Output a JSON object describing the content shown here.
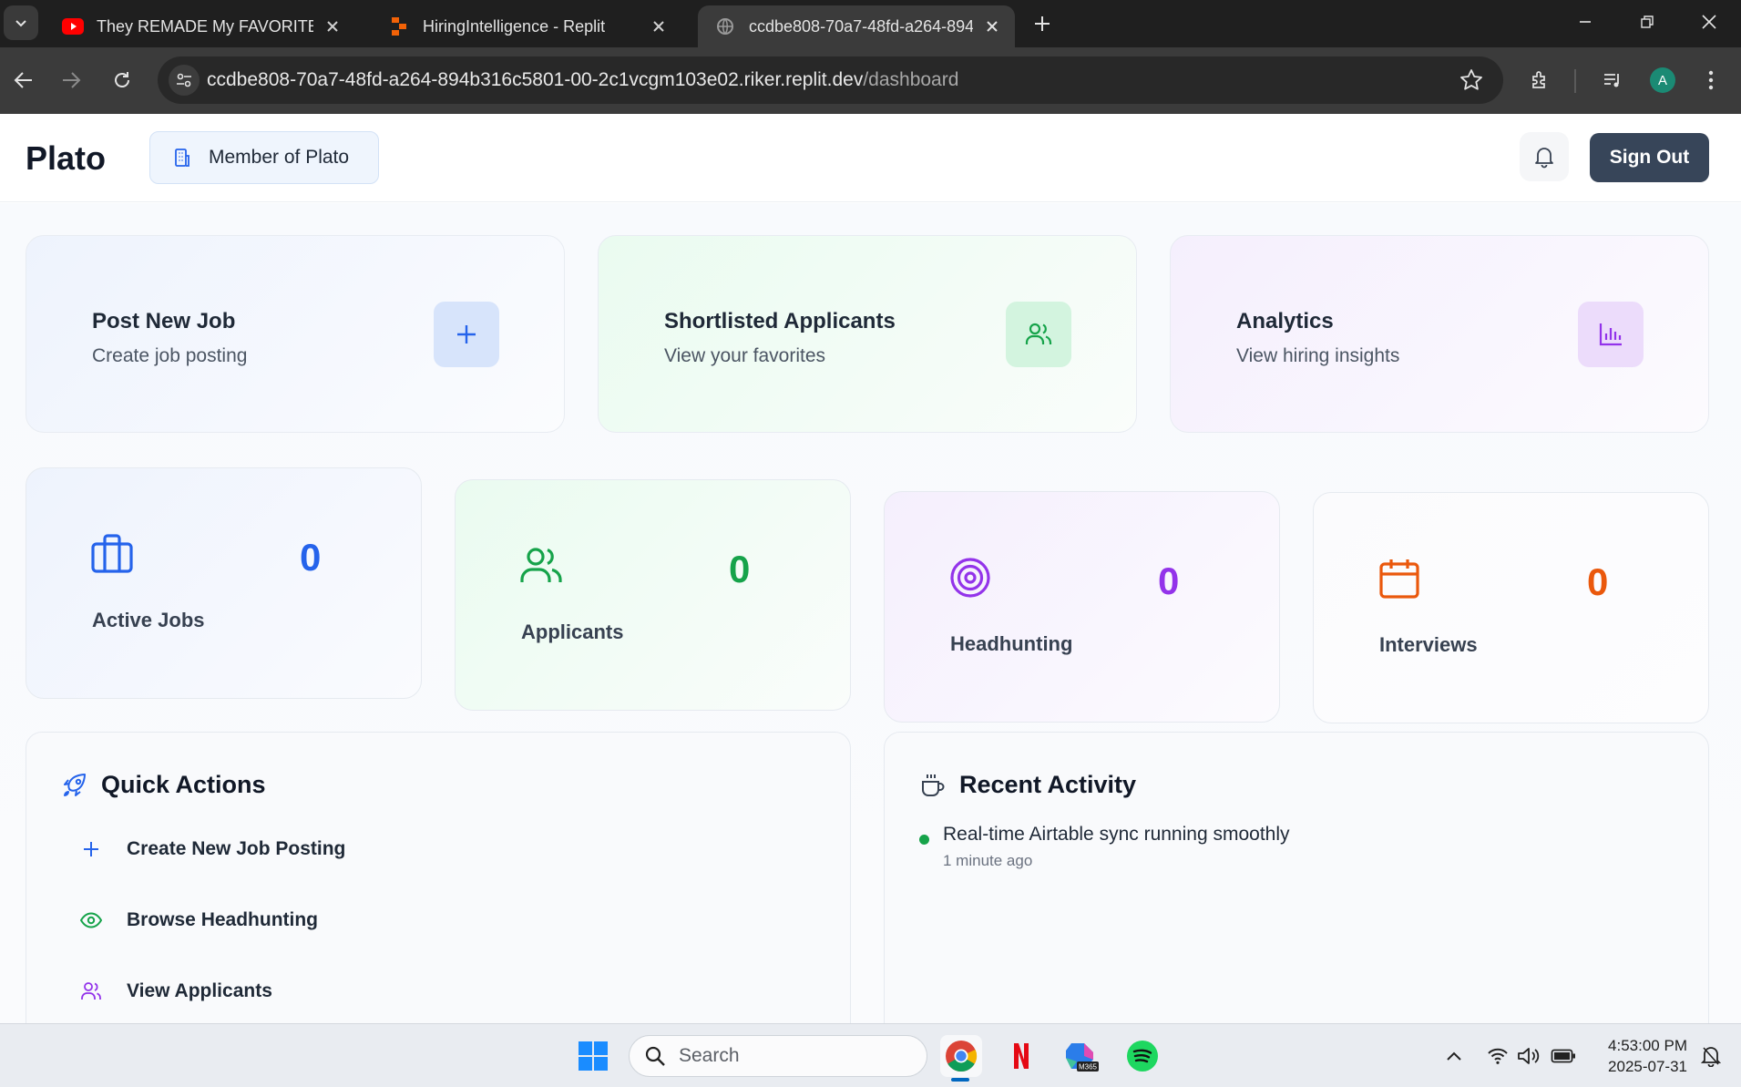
{
  "browser": {
    "tabs": [
      {
        "title": "They REMADE My FAVORITE Ga",
        "favicon": "youtube-icon",
        "active": false
      },
      {
        "title": "HiringIntelligence - Replit",
        "favicon": "replit-icon",
        "active": false
      },
      {
        "title": "ccdbe808-70a7-48fd-a264-894",
        "favicon": "globe-icon",
        "active": true
      }
    ],
    "url_host": "ccdbe808-70a7-48fd-a264-894b316c5801-00-2c1vcgm103e02.riker.replit.dev",
    "url_path": "/dashboard",
    "profile_initial": "A",
    "profile_color": "#1b8a74"
  },
  "app": {
    "brand": "Plato",
    "member_badge": "Member of Plato",
    "sign_out": "Sign Out"
  },
  "quick_cards": [
    {
      "title": "Post New Job",
      "subtitle": "Create job posting",
      "icon": "plus-icon",
      "color": "#2563eb"
    },
    {
      "title": "Shortlisted Applicants",
      "subtitle": "View your favorites",
      "icon": "users-icon",
      "color": "#16a34a"
    },
    {
      "title": "Analytics",
      "subtitle": "View hiring insights",
      "icon": "bar-chart-icon",
      "color": "#9333ea"
    }
  ],
  "stats": [
    {
      "label": "Active Jobs",
      "value": "0",
      "icon": "briefcase-icon",
      "color": "#2563eb"
    },
    {
      "label": "Applicants",
      "value": "0",
      "icon": "users-icon",
      "color": "#16a34a"
    },
    {
      "label": "Headhunting",
      "value": "0",
      "icon": "target-icon",
      "color": "#9333ea"
    },
    {
      "label": "Interviews",
      "value": "0",
      "icon": "calendar-icon",
      "color": "#ea580c"
    }
  ],
  "quick_actions": {
    "title": "Quick Actions",
    "items": [
      {
        "label": "Create New Job Posting",
        "icon": "plus-icon"
      },
      {
        "label": "Browse Headhunting",
        "icon": "eye-icon"
      },
      {
        "label": "View Applicants",
        "icon": "users-icon"
      }
    ]
  },
  "recent_activity": {
    "title": "Recent Activity",
    "items": [
      {
        "text": "Real-time Airtable sync running smoothly",
        "time": "1 minute ago"
      }
    ]
  },
  "taskbar": {
    "search_placeholder": "Search",
    "time": "4:53:00 PM",
    "date": "2025-07-31"
  }
}
